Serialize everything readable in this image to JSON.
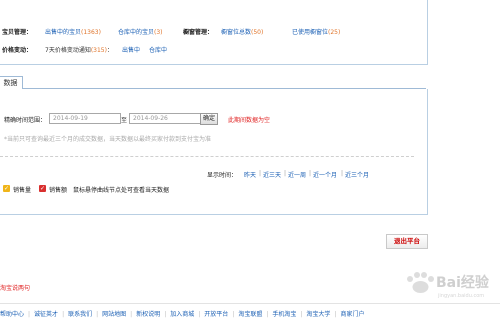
{
  "summary": {
    "baby_mgmt_label": "宝贝管理：",
    "on_sale_label": "出售中的宝贝",
    "on_sale_count": "(1363)",
    "warehouse_label": "仓库中的宝贝",
    "warehouse_count": "(3)",
    "showcase_mgmt_label": "橱窗管理：",
    "showcase_total_label": "橱窗位总数",
    "showcase_total_count": "(50)",
    "showcase_used_label": "已使用橱窗位",
    "showcase_used_count": "(25)",
    "price_change_label": "价格变动：",
    "price_notice_label": "7天价格变动通知",
    "price_notice_count": "(315)",
    "price_notice_sep": "：",
    "price_on_sale_link": "出售中",
    "price_warehouse_link": "仓库中"
  },
  "tab": {
    "label": "数据"
  },
  "query": {
    "range_label": "精确时间范围：",
    "start_date": "2014-09-19",
    "to_label": "至",
    "end_date": "2014-09-26",
    "confirm_button": "确定",
    "empty_msg": "此期间数据为空",
    "hint": "*当前只可查询最近三个月的成交数据，当天数据以最终买家付款到支付宝为准"
  },
  "display": {
    "label": "显示时间：",
    "opt_yesterday": "昨天",
    "opt_3days": "近三天",
    "opt_week": "近一周",
    "opt_month": "近一个月",
    "opt_3months": "近三个月",
    "sep": "|"
  },
  "legend": {
    "sales_qty": "销售量",
    "sales_amt": "销售额",
    "tip": "鼠标悬停曲线节点处可查看当天数据",
    "color_qty": "#f0b51a",
    "color_amt": "#d9302f"
  },
  "actions": {
    "exit": "退出平台"
  },
  "footer": {
    "feedback": "淘宝说两句",
    "links": [
      "帮助中心",
      "诚征英才",
      "联系我们",
      "网站地图",
      "新权说明",
      "加入商城",
      "开放平台",
      "淘宝联盟",
      "手机淘宝",
      "淘宝大学",
      "商家门户"
    ],
    "separator": "|"
  },
  "watermark": {
    "text": "Bai经验",
    "sub": "jingyan.baidu.com"
  }
}
